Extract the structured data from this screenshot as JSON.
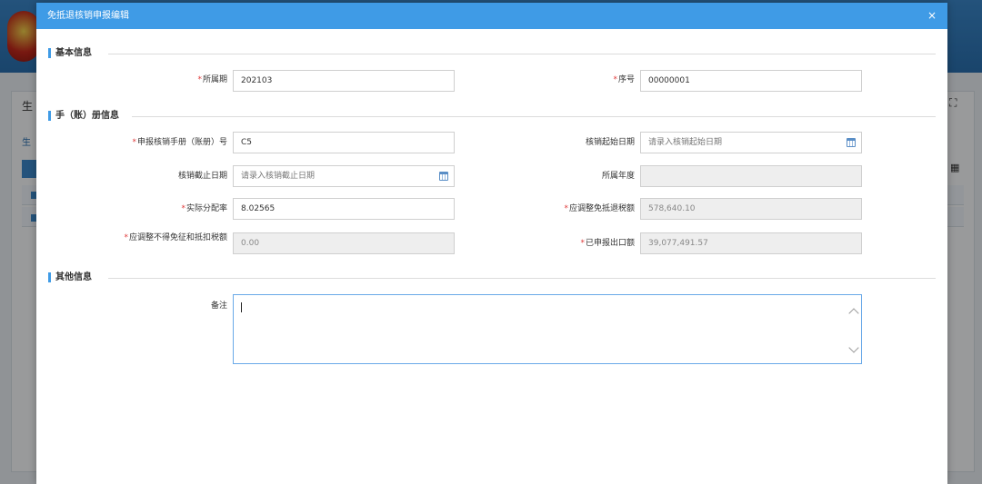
{
  "modal": {
    "title": "免抵退核销申报编辑",
    "close_glyph": "×"
  },
  "background": {
    "title_fragment": "生",
    "breadcrumb_fragment": "生",
    "icon_right_1": "expand-icon",
    "icon_right_2": "grid-icon"
  },
  "sections": {
    "basic": "基本信息",
    "manual": "手（账）册信息",
    "other": "其他信息"
  },
  "required_mark": "*",
  "fields": {
    "period": {
      "label": "所属期",
      "value": "202103"
    },
    "seq": {
      "label": "序号",
      "value": "00000001"
    },
    "manual_no": {
      "label": "申报核销手册（账册）号",
      "value": "C5"
    },
    "start_date": {
      "label": "核销起始日期",
      "placeholder": "请录入核销起始日期"
    },
    "end_date": {
      "label": "核销截止日期",
      "placeholder": "请录入核销截止日期"
    },
    "year": {
      "label": "所属年度",
      "value": ""
    },
    "rate": {
      "label": "实际分配率",
      "value": "8.02565"
    },
    "adj_refund": {
      "label": "应调整免抵退税额",
      "value": "578,640.10"
    },
    "adj_nondeduct": {
      "label": "应调整不得免征和抵扣税额",
      "value": "0.00"
    },
    "declared_export": {
      "label": "已申报出口额",
      "value": "39,077,491.57"
    },
    "remark": {
      "label": "备注",
      "value": ""
    }
  }
}
